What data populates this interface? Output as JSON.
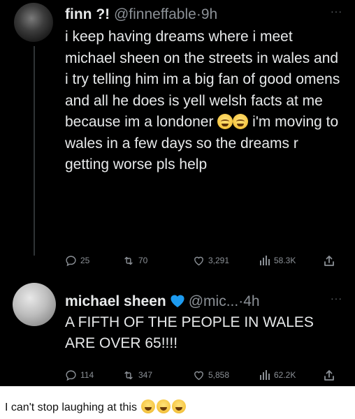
{
  "tweets": [
    {
      "display_name": "finn ?!",
      "handle": "@finneffable",
      "separator": "·",
      "time": "9h",
      "more": "···",
      "text_before_emoji": "i keep having dreams where i meet michael sheen on the streets in wales and i try telling him im a big fan of good omens and all he does is yell welsh facts at me because im a londoner ",
      "text_after_emoji": " i'm moving to wales in a few days so the dreams r getting worse pls help",
      "emoji_icon": "crying-laughing-face-icon",
      "replies": "25",
      "retweets": "70",
      "likes": "3,291",
      "views": "58.3K"
    },
    {
      "display_name": "michael sheen",
      "name_emoji": "blue-heart-icon",
      "handle": "@mic...",
      "separator": "·",
      "time": "4h",
      "more": "···",
      "text": "A FIFTH OF THE PEOPLE IN WALES ARE OVER 65!!!!",
      "replies": "114",
      "retweets": "347",
      "likes": "5,858",
      "views": "62.2K"
    }
  ],
  "caption": {
    "text": "I can't stop laughing at this",
    "emoji_icons": [
      "rofl-face-icon",
      "joy-face-icon",
      "rofl-face-icon"
    ]
  },
  "colors": {
    "background": "#000000",
    "text": "#e7e9ea",
    "muted": "#8b9096",
    "verified": "#1d9bf0"
  }
}
